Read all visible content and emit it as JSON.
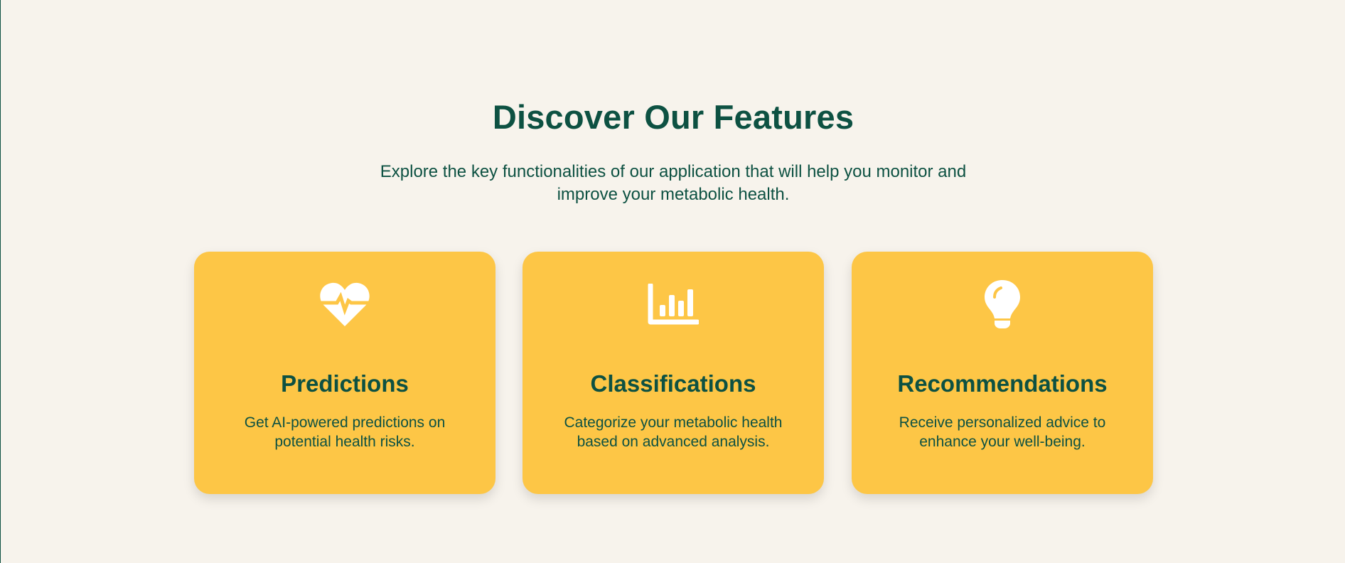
{
  "section": {
    "title": "Discover Our Features",
    "subtitle": "Explore the key functionalities of our application that will help you monitor and improve your metabolic health."
  },
  "colors": {
    "background": "#f7f3ec",
    "primary_text": "#0d5142",
    "card_background": "#fdc646",
    "icon_color": "#ffffff"
  },
  "features": [
    {
      "icon": "heart-pulse-icon",
      "title": "Predictions",
      "description": "Get AI-powered predictions on potential health risks."
    },
    {
      "icon": "bar-chart-icon",
      "title": "Classifications",
      "description": "Categorize your metabolic health based on advanced analysis."
    },
    {
      "icon": "lightbulb-icon",
      "title": "Recommendations",
      "description": "Receive personalized advice to enhance your well-being."
    }
  ]
}
